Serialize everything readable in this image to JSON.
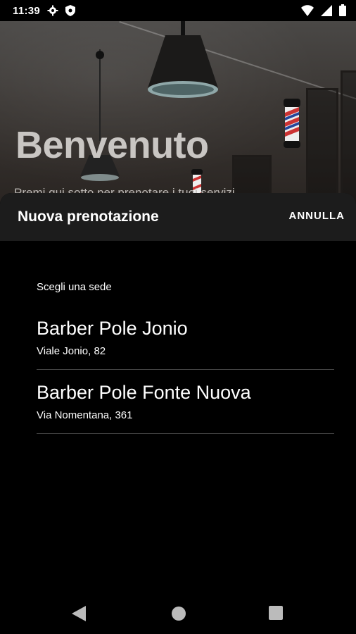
{
  "status_bar": {
    "time": "11:39",
    "left_icons": [
      "gear-icon",
      "shield-icon"
    ],
    "right_icons": [
      "wifi-icon",
      "signal-icon",
      "battery-icon"
    ]
  },
  "hero": {
    "title": "Benvenuto",
    "subtitle": "Premi qui sotto per prenotare i tuoi servizi"
  },
  "sheet": {
    "title": "Nuova prenotazione",
    "cancel_label": "ANNULLA",
    "section_label": "Scegli una sede",
    "locations": [
      {
        "name": "Barber Pole Jonio",
        "address": "Viale Jonio, 82"
      },
      {
        "name": "Barber Pole Fonte Nuova",
        "address": "Via Nomentana, 361"
      }
    ]
  },
  "nav_bar": {
    "buttons": [
      "back-icon",
      "home-icon",
      "recents-icon"
    ]
  }
}
